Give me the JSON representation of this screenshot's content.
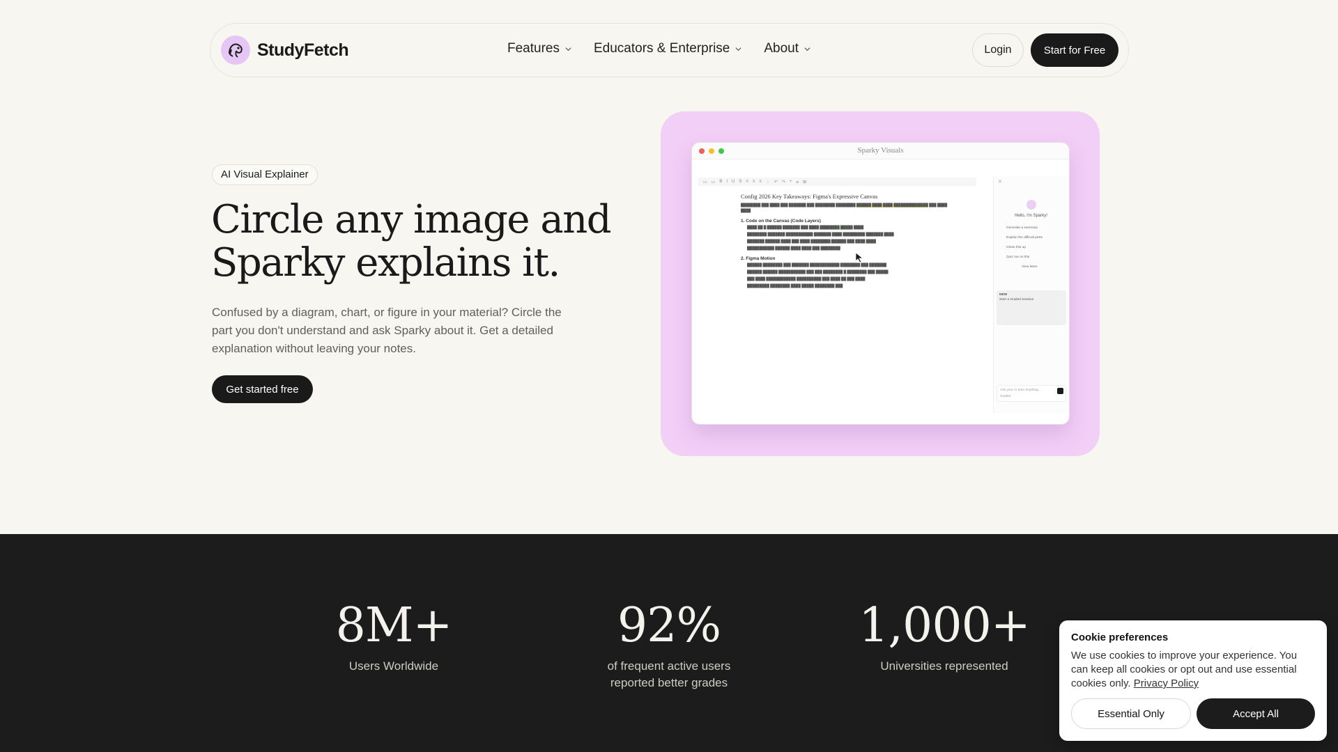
{
  "nav": {
    "brand": "StudyFetch",
    "links": [
      {
        "label": "Features"
      },
      {
        "label": "Educators & Enterprise"
      },
      {
        "label": "About"
      }
    ],
    "login_label": "Login",
    "start_label": "Start for Free"
  },
  "hero": {
    "badge": "AI Visual Explainer",
    "title": "Circle any image and Sparky explains it.",
    "subtitle": "Confused by a diagram, chart, or figure in your material? Circle the part you don't understand and ask Sparky about it. Get a detailed explanation without leaving your notes.",
    "cta_label": "Get started free"
  },
  "showcase": {
    "window_title": "Sparky Visuals",
    "doc_title": "Config 2026 Key Takeaways: Figma's Expressive Canvas",
    "section1": "1. Code on the Canvas (Code Layers)",
    "section2": "2. Figma Motion",
    "sidebar_greeting": "Hello, I'm Sparky!",
    "sidebar_actions": [
      "Generate a summary",
      "Explain the difficult parts",
      "Clean this up",
      "Quiz me on this",
      "View More"
    ],
    "sidebar_card_badge": "NEW",
    "sidebar_card_title": "Start a Guided Session",
    "input_placeholder": "Ask your AI tutor anything...",
    "input_mode": "Guided"
  },
  "stats": [
    {
      "value": "8M+",
      "label": "Users Worldwide"
    },
    {
      "value": "92%",
      "label": "of frequent active users reported better grades"
    },
    {
      "value": "1,000+",
      "label": "Universities represented"
    }
  ],
  "cookie": {
    "title": "Cookie preferences",
    "text": "We use cookies to improve your experience. You can keep all cookies or opt out and use essential cookies only.",
    "link": "Privacy Policy",
    "essential_label": "Essential Only",
    "accept_label": "Accept All"
  },
  "colors": {
    "background": "#f7f6f0",
    "dark": "#1c1c1c",
    "showcase_bg": "#f2cff7",
    "brand_logo": "#e6c6f4"
  }
}
